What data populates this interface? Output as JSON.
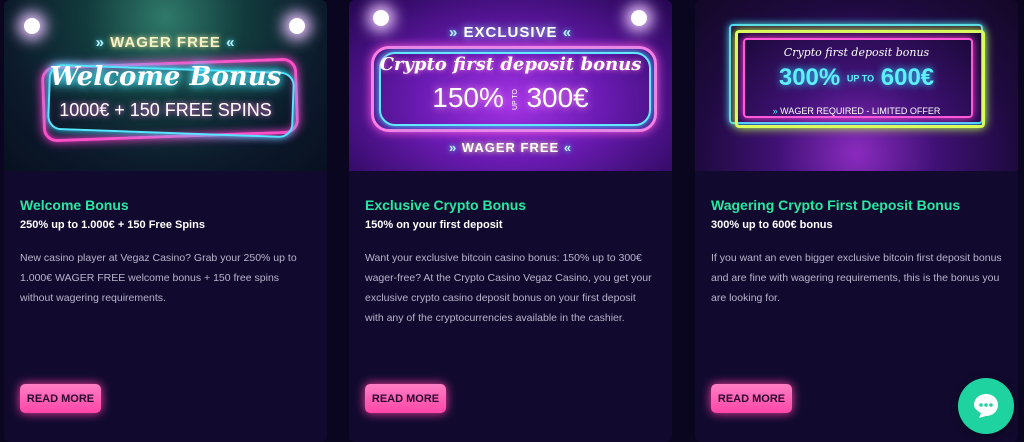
{
  "cards": [
    {
      "banner": {
        "tag": "WAGER FREE",
        "headline": "Welcome Bonus",
        "line": "1000€ + 150 FREE SPINS"
      },
      "title": "Welcome Bonus",
      "subtitle": "250% up to 1.000€ + 150 Free Spins",
      "description": "New casino player at Vegaz Casino? Grab your 250% up to 1.000€ WAGER FREE welcome bonus + 150 free spins without wagering requirements.",
      "button": "READ MORE"
    },
    {
      "banner": {
        "tag": "EXCLUSIVE",
        "headline": "Crypto first deposit bonus",
        "percent": "150%",
        "upto": "UP TO",
        "amount": "300€",
        "footer": "WAGER FREE"
      },
      "title": "Exclusive Crypto Bonus",
      "subtitle": "150% on your first deposit",
      "description": "Want your exclusive bitcoin casino bonus: 150% up to 300€ wager-free? At the Crypto Casino Vegaz Casino, you get your exclusive crypto casino deposit bonus on your first deposit with any of the cryptocurrencies available in the cashier.",
      "button": "READ MORE"
    },
    {
      "banner": {
        "tag": "Crypto first deposit bonus",
        "percent": "300%",
        "upto": "UP TO",
        "amount": "600€",
        "footer": "WAGER REQUIRED - LIMITED OFFER"
      },
      "title": "Wagering Crypto First Deposit Bonus",
      "subtitle": "300% up to 600€ bonus",
      "description": "If you want an even bigger exclusive bitcoin first deposit bonus and are fine with wagering requirements, this is the bonus you are looking for.",
      "button": "READ MORE"
    }
  ],
  "chat": {
    "icon": "chat-bubble-icon"
  },
  "colors": {
    "title": "#27e8a2",
    "button": "#ff5db5",
    "chat": "#1fd3a1",
    "background": "#0b0620"
  }
}
